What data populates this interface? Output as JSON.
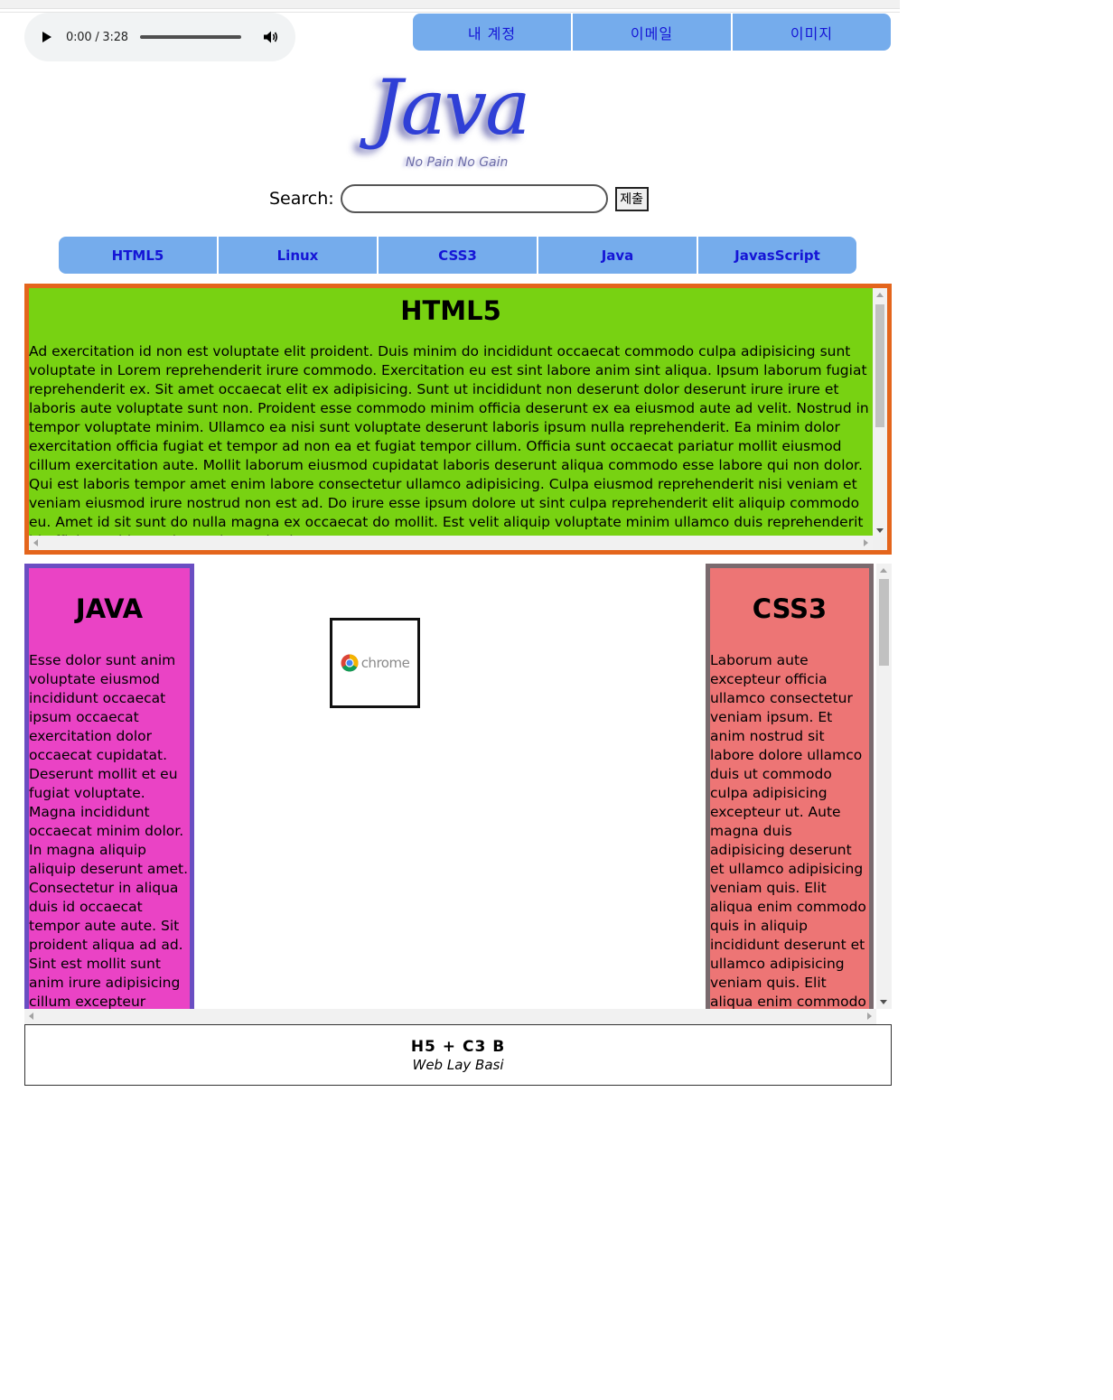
{
  "audio": {
    "time_display": "0:00 / 3:28",
    "progress": 0
  },
  "top_menu": {
    "items": [
      "내 계정",
      "이메일",
      "이미지"
    ]
  },
  "logo": {
    "text": "Java",
    "slogan": "No Pain No Gain"
  },
  "search": {
    "label": "Search:",
    "value": "",
    "button_label": "제출"
  },
  "nav": {
    "items": [
      "HTML5",
      "Linux",
      "CSS3",
      "Java",
      "JavasScript"
    ]
  },
  "html5_section": {
    "title": "HTML5",
    "body": "Ad exercitation id non est voluptate elit proident. Duis minim do incididunt occaecat commodo culpa adipisicing sunt voluptate in Lorem reprehenderit irure commodo. Exercitation eu est sint labore anim sint aliqua. Ipsum laborum fugiat reprehenderit ex. Sit amet occaecat elit ex adipisicing. Sunt ut incididunt non deserunt dolor deserunt irure irure et laboris aute voluptate sunt non. Proident esse commodo minim officia deserunt ex ea eiusmod aute ad velit. Nostrud in tempor voluptate minim. Ullamco ea nisi sunt voluptate deserunt laboris ipsum nulla reprehenderit. Ea minim dolor exercitation officia fugiat et tempor ad non ea et fugiat tempor cillum. Officia sunt occaecat pariatur mollit eiusmod cillum exercitation aute. Mollit laborum eiusmod cupidatat laboris deserunt aliqua commodo esse labore qui non dolor. Qui est laboris tempor amet enim labore consectetur ullamco adipisicing. Culpa eiusmod reprehenderit nisi veniam et veniam eiusmod irure nostrud non est ad. Do irure esse ipsum dolore ut sint culpa reprehenderit elit aliquip commodo eu. Amet id sit sunt do nulla magna ex occaecat do mollit. Est velit aliquip voluptate minim ullamco duis reprehenderit id officia cupidatat eiusmod exercitation. Excepteur aute"
  },
  "java_section": {
    "title": "JAVA",
    "body": "Esse dolor sunt anim voluptate eiusmod incididunt occaecat ipsum occaecat exercitation dolor occaecat cupidatat. Deserunt mollit et eu fugiat voluptate. Magna incididunt occaecat minim dolor. In magna aliquip aliquip deserunt amet. Consectetur in aliqua duis id occaecat tempor aute aute. Sit proident aliqua ad ad. Sint est mollit sunt anim irure adipisicing cillum excepteur minim minim sunt sunt fugiat sint."
  },
  "css3_section": {
    "title": "CSS3",
    "body": "Laborum aute excepteur officia ullamco consectetur veniam ipsum. Et anim nostrud sit labore dolore ullamco duis ut commodo culpa adipisicing excepteur ut. Aute magna duis adipisicing deserunt et ullamco adipisicing veniam quis. Elit aliqua enim commodo quis in aliquip incididunt deserunt et ullamco adipisicing veniam quis. Elit aliqua enim commodo quis in aliquip incididunt"
  },
  "center_image": {
    "label": "chrome"
  },
  "footer": {
    "title": "H5 + C3 B",
    "subtitle": "Web Lay Basi"
  },
  "colors": {
    "menu_bg": "#75acec",
    "menu_text": "#1515d6",
    "html5_bg": "#78d212",
    "html5_border": "#e4651c",
    "java_bg": "#ea43c5",
    "java_border": "#6a4ec2",
    "css3_bg": "#ed7575",
    "css3_border": "#7a6a6e",
    "logo": "#2f3fd6"
  },
  "icons": [
    "play-icon",
    "volume-icon",
    "chrome-logo-icon"
  ]
}
